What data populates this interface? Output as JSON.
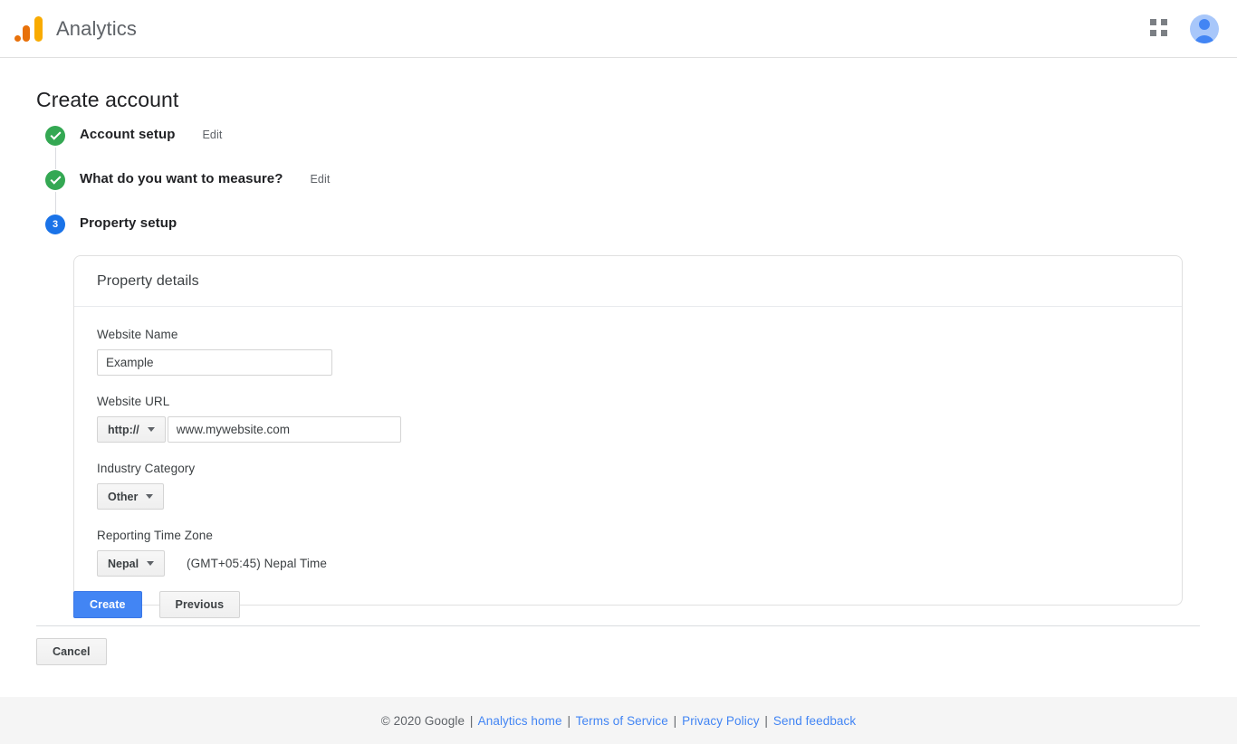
{
  "header": {
    "logo_icon": "google-analytics-logo",
    "product_name": "Analytics",
    "apps_icon": "apps-grid-icon",
    "avatar_icon": "user-avatar-icon",
    "colors": {
      "logo_tall_bar": "#f9ab00",
      "logo_mid_bar": "#e8710a",
      "logo_dot": "#e8710a",
      "avatar_bg": "#a8c7fa",
      "avatar_fg": "#4285f4"
    }
  },
  "page": {
    "title": "Create account"
  },
  "stepper": {
    "steps": [
      {
        "label": "Account setup",
        "state": "done",
        "marker": "check",
        "edit_label": "Edit",
        "has_edit": true
      },
      {
        "label": "What do you want to measure?",
        "state": "done",
        "marker": "check",
        "edit_label": "Edit",
        "has_edit": true
      },
      {
        "label": "Property setup",
        "state": "current",
        "marker": "3",
        "edit_label": "",
        "has_edit": false
      }
    ],
    "colors": {
      "done": "#34a853",
      "current": "#1a73e8",
      "connector": "#dadce0"
    }
  },
  "card": {
    "header_title": "Property details",
    "fields": {
      "website_name": {
        "label": "Website Name",
        "value": "Example",
        "placeholder": "Website Name"
      },
      "website_url": {
        "label": "Website URL",
        "protocol_value": "http://",
        "value": "www.mywebsite.com",
        "placeholder": "www.mywebsite.com"
      },
      "industry_category": {
        "label": "Industry Category",
        "value": "Other"
      },
      "reporting_time_zone": {
        "label": "Reporting Time Zone",
        "value": "Nepal",
        "detail": "(GMT+05:45) Nepal Time"
      }
    }
  },
  "actions": {
    "create_label": "Create",
    "previous_label": "Previous",
    "cancel_label": "Cancel",
    "primary_color": "#4285f4"
  },
  "footer": {
    "copyright": "© 2020 Google",
    "separator": "|",
    "links": [
      "Analytics home",
      "Terms of Service",
      "Privacy Policy",
      "Send feedback"
    ],
    "link_color": "#4285f4"
  }
}
